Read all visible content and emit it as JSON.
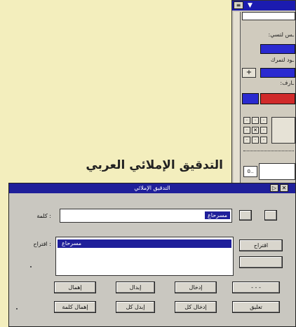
{
  "heading": "التدقيق الإملائي العربي",
  "palette": {
    "labels": [
      ":ـس لتسي",
      "ـود لتمرك",
      ":ـارف"
    ],
    "bottom_field": "0.."
  },
  "dialog": {
    "title": "التدقيق الإملائي",
    "word_label": ": كلمة",
    "word_value": "مسرحاع",
    "suggestions_label": ": اقتراح",
    "suggestion_item": "مسرحاع",
    "buttons": {
      "suggest": "اقتراح",
      "ignore": "إهمال",
      "replace": "إبدال",
      "add": "إدخال",
      "ignore_all": "إهمال كلمة",
      "replace_all": "إبدل كل",
      "add_all": "إدخال كل",
      "cancel": "تعليق",
      "side_top": "",
      "side_bottom": "- - -"
    }
  },
  "colors": {
    "titlebar": "#1f1f9a",
    "background": "#f3eebd",
    "swatch_blue": "#2a2ad0",
    "swatch_red": "#d02a2a"
  }
}
